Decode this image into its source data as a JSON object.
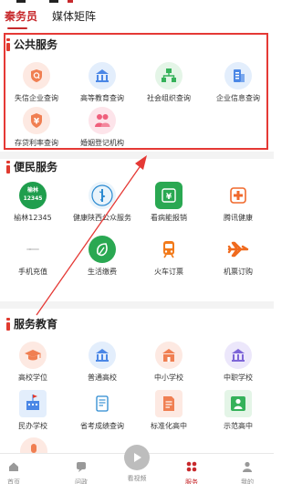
{
  "top_tabs": [
    "秦务员",
    "媒体矩阵"
  ],
  "sections": {
    "public": {
      "title": "公共服务",
      "items": [
        {
          "label": "失信企业查询",
          "icon": "shield-search-icon",
          "bg": "#fde9e2",
          "fg": "#f07f52"
        },
        {
          "label": "高等教育查询",
          "icon": "university-icon",
          "bg": "#e3eefc",
          "fg": "#4b87e6"
        },
        {
          "label": "社会组织查询",
          "icon": "organization-chart-icon",
          "bg": "#e4f5e7",
          "fg": "#35b25a"
        },
        {
          "label": "企业信息查询",
          "icon": "building-icon",
          "bg": "#e3eefc",
          "fg": "#4b87e6"
        },
        {
          "label": "存贷利率查询",
          "icon": "yuan-rate-icon",
          "bg": "#fde9e2",
          "fg": "#f07f52"
        },
        {
          "label": "婚姻登记机构",
          "icon": "couple-icon",
          "bg": "#fde4ea",
          "fg": "#ef5f7c"
        }
      ]
    },
    "civil": {
      "title": "便民服务",
      "items": [
        {
          "label": "榆林12345",
          "icon": "hotline-badge-icon",
          "badge_line1": "榆林",
          "badge_line2": "12345",
          "bg": "#1f9e4d",
          "fg": "#ffffff"
        },
        {
          "label": "健康陕西公众服务",
          "icon": "health-emblem-icon",
          "bg": "#eaf4fb",
          "fg": "#2b8ad1"
        },
        {
          "label": "看病能报销",
          "icon": "medical-bill-icon",
          "bg": "#2aa852",
          "fg": "#ffffff"
        },
        {
          "label": "腾讯健康",
          "icon": "health-cross-icon",
          "bg": "#ffffff",
          "fg": "#f0692c"
        },
        {
          "label": "手机充值",
          "icon": "phone-recharge-icon",
          "bg": "#ffffff",
          "fg": "#cfcfcf"
        },
        {
          "label": "生活缴费",
          "icon": "leaf-payment-icon",
          "bg": "#2aa852",
          "fg": "#ffffff"
        },
        {
          "label": "火车订票",
          "icon": "train-icon",
          "bg": "#ffffff",
          "fg": "#f27a1a"
        },
        {
          "label": "机票订购",
          "icon": "airplane-icon",
          "bg": "#ffffff",
          "fg": "#f06a1e"
        }
      ]
    },
    "education": {
      "title": "服务教育",
      "items": [
        {
          "label": "高校学位",
          "icon": "graduation-cap-icon",
          "bg": "#fde9e2",
          "fg": "#f07f52"
        },
        {
          "label": "普通高校",
          "icon": "university-icon",
          "bg": "#e3eefc",
          "fg": "#4b87e6"
        },
        {
          "label": "中小学校",
          "icon": "school-building-icon",
          "bg": "#fde9e2",
          "fg": "#f07f52"
        },
        {
          "label": "中职学校",
          "icon": "school-building-icon",
          "bg": "#ece7fb",
          "fg": "#7e66d8"
        },
        {
          "label": "民办学校",
          "icon": "flag-building-icon",
          "bg": "#e3eefc",
          "fg": "#4b87e6"
        },
        {
          "label": "省考成绩查询",
          "icon": "exam-score-icon",
          "bg": "#ffffff",
          "fg": "#2b8ad1"
        },
        {
          "label": "标准化高中",
          "icon": "document-standard-icon",
          "bg": "#fde9e2",
          "fg": "#f07f52"
        },
        {
          "label": "示范高中",
          "icon": "student-person-icon",
          "bg": "#e4f5e7",
          "fg": "#35b25a"
        }
      ]
    }
  },
  "bottom_nav": [
    {
      "label": "首页",
      "icon": "home-icon"
    },
    {
      "label": "问政",
      "icon": "chat-icon"
    },
    {
      "label": "看视频",
      "icon": "video-icon"
    },
    {
      "label": "服务",
      "icon": "service-grid-icon",
      "active": true
    },
    {
      "label": "我的",
      "icon": "user-icon"
    }
  ],
  "colors": {
    "accent": "#c7292c",
    "highlight": "#e53935",
    "arrow": "#e53935"
  }
}
